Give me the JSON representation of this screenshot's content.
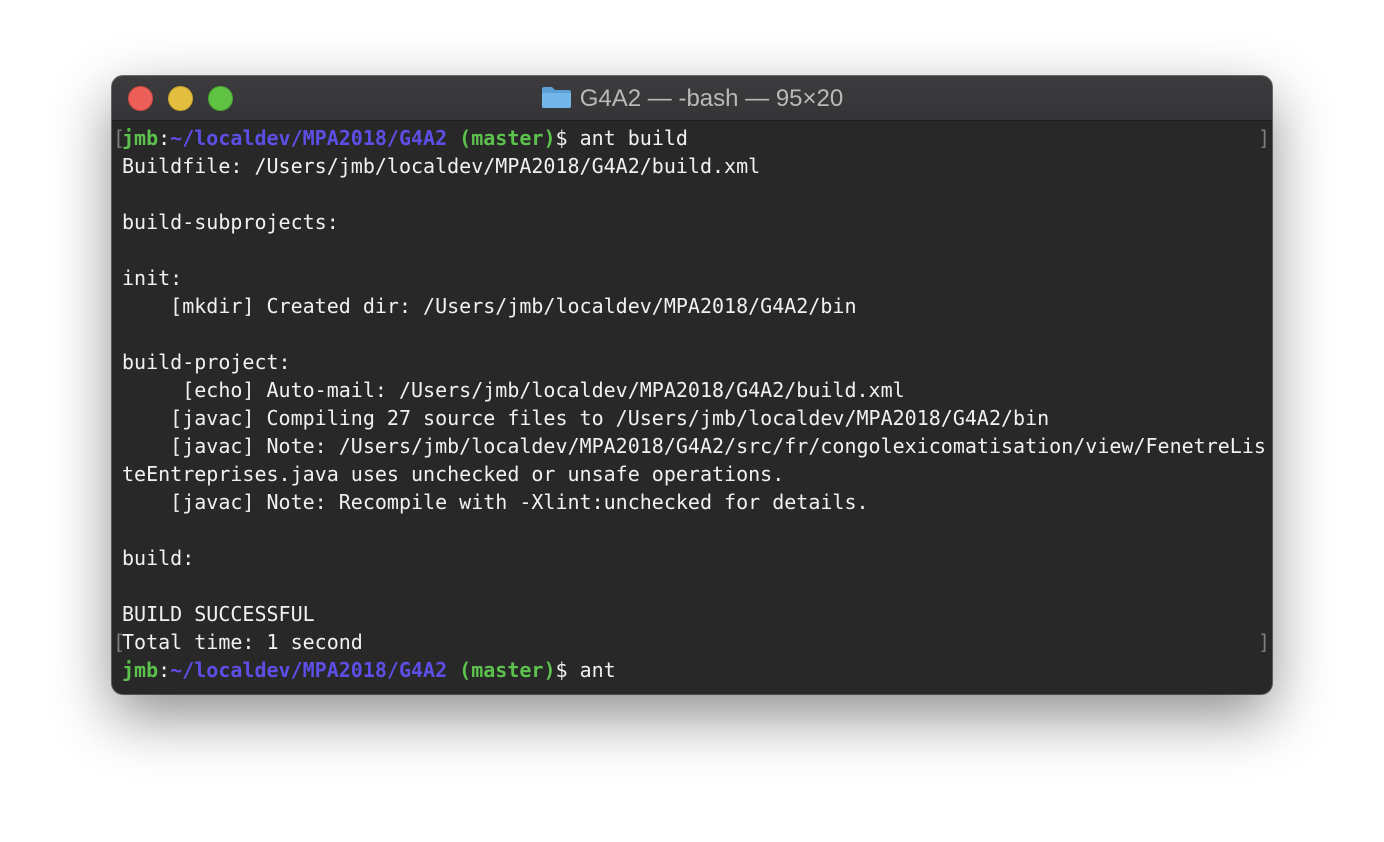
{
  "window": {
    "title": "G4A2 — -bash — 95×20",
    "folder_icon": "folder-icon",
    "colors": {
      "background": "#282828",
      "text": "#f1f1f1",
      "prompt_user": "#5cc24d",
      "prompt_path": "#5d4ee6",
      "prompt_branch": "#5cc24d",
      "close": "#ec5f58",
      "minimize": "#e4be3e",
      "zoom": "#5fc242"
    }
  },
  "prompt1": {
    "user": "jmb",
    "sep": ":",
    "path": "~/localdev/MPA2018/G4A2",
    "space": " ",
    "branch": "(master)",
    "dollar": "$ ",
    "command": "ant build"
  },
  "output": [
    "Buildfile: /Users/jmb/localdev/MPA2018/G4A2/build.xml",
    "",
    "build-subprojects:",
    "",
    "init:",
    "    [mkdir] Created dir: /Users/jmb/localdev/MPA2018/G4A2/bin",
    "",
    "build-project:",
    "     [echo] Auto-mail: /Users/jmb/localdev/MPA2018/G4A2/build.xml",
    "    [javac] Compiling 27 source files to /Users/jmb/localdev/MPA2018/G4A2/bin",
    "    [javac] Note: /Users/jmb/localdev/MPA2018/G4A2/src/fr/congolexicomatisation/view/FenetreLis",
    "teEntreprises.java uses unchecked or unsafe operations.",
    "    [javac] Note: Recompile with -Xlint:unchecked for details.",
    "",
    "build:",
    "",
    "BUILD SUCCESSFUL",
    "Total time: 1 second"
  ],
  "prompt2": {
    "user": "jmb",
    "sep": ":",
    "path": "~/localdev/MPA2018/G4A2",
    "space": " ",
    "branch": "(master)",
    "dollar": "$ ",
    "command": "ant"
  },
  "marks": {
    "open": "[",
    "close": "]"
  }
}
